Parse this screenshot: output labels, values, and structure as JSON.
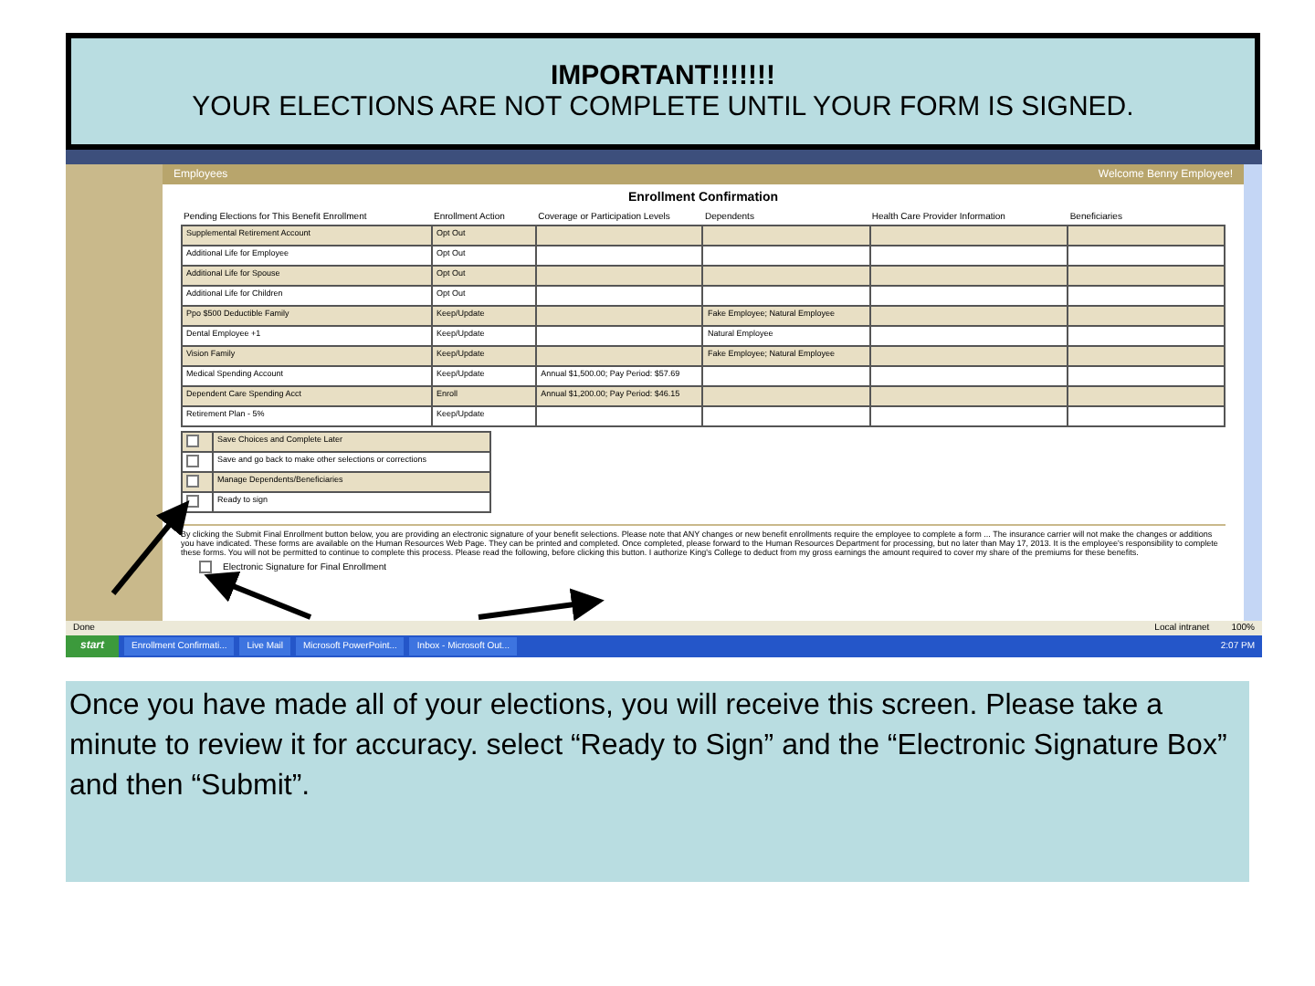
{
  "banner": {
    "heading": "IMPORTANT!!!!!!!",
    "message": "YOUR ELECTIONS ARE NOT COMPLETE UNTIL YOUR FORM IS SIGNED."
  },
  "screen": {
    "section": "Employees",
    "welcome": "Welcome Benny Employee!",
    "page_title": "Enrollment Confirmation",
    "table": {
      "columns": [
        "Pending Elections for This Benefit Enrollment",
        "Enrollment Action",
        "Coverage or Participation Levels",
        "Dependents",
        "Health Care Provider Information",
        "Beneficiaries"
      ],
      "rows": [
        {
          "election": "Supplemental Retirement Account",
          "action": "Opt Out",
          "coverage": "",
          "dependents": ""
        },
        {
          "election": "Additional Life for Employee",
          "action": "Opt Out",
          "coverage": "",
          "dependents": ""
        },
        {
          "election": "Additional Life for Spouse",
          "action": "Opt Out",
          "coverage": "",
          "dependents": ""
        },
        {
          "election": "Additional Life for Children",
          "action": "Opt Out",
          "coverage": "",
          "dependents": ""
        },
        {
          "election": "Ppo $500 Deductible Family",
          "action": "Keep/Update",
          "coverage": "",
          "dependents": "Fake Employee; Natural Employee"
        },
        {
          "election": "Dental Employee +1",
          "action": "Keep/Update",
          "coverage": "",
          "dependents": "Natural Employee"
        },
        {
          "election": "Vision Family",
          "action": "Keep/Update",
          "coverage": "",
          "dependents": "Fake Employee; Natural Employee"
        },
        {
          "election": "Medical Spending Account",
          "action": "Keep/Update",
          "coverage": "Annual $1,500.00; Pay Period: $57.69",
          "dependents": ""
        },
        {
          "election": "Dependent Care Spending Acct",
          "action": "Enroll",
          "coverage": "Annual $1,200.00; Pay Period: $46.15",
          "dependents": ""
        },
        {
          "election": "Retirement Plan - 5%",
          "action": "Keep/Update",
          "coverage": "",
          "dependents": ""
        }
      ]
    },
    "options": [
      {
        "label": "Save Choices and Complete Later",
        "checked": false
      },
      {
        "label": "Save and go back to make other selections or corrections",
        "checked": false
      },
      {
        "label": "Manage Dependents/Beneficiaries",
        "checked": false
      },
      {
        "label": "Ready to sign",
        "checked": false
      }
    ],
    "notice": "By clicking the Submit Final Enrollment button below, you are providing an electronic signature of your benefit selections. Please note that ANY changes or new benefit enrollments require the employee to complete a form ... The insurance carrier will not make the changes or additions you have indicated. These forms are available on the Human Resources Web Page. They can be printed and completed. Once completed, please forward to the Human Resources Department for processing, but no later than May 17, 2013. It is the employee's responsibility to complete these forms. You will not be permitted to continue to complete this process. Please read the following, before clicking this button. I authorize King's College to deduct from my gross earnings the amount required to cover my share of the premiums for these benefits.",
    "signature": {
      "label": "Electronic Signature for Final Enrollment",
      "checked": false
    },
    "status_bar": {
      "status": "Done",
      "zone": "Local intranet",
      "zoom": "100%"
    },
    "taskbar": {
      "start": "start",
      "items": [
        "Enrollment Confirmati...",
        "Live Mail",
        "Microsoft PowerPoint...",
        "Inbox - Microsoft Out..."
      ],
      "clock": "2:07 PM"
    }
  },
  "caption": "Once you have made all of your elections, you will receive this screen.  Please take a minute to review it for accuracy. select “Ready to Sign” and the “Electronic Signature Box”  and then “Submit”."
}
